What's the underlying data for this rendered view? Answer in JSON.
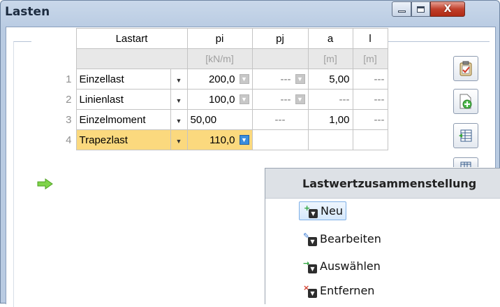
{
  "window": {
    "title": "Lasten",
    "minimize_icon": "minimize-icon",
    "maximize_icon": "maximize-icon",
    "close_glyph": "X"
  },
  "table": {
    "headers": {
      "type": "Lastart",
      "pi": "pi",
      "pj": "pj",
      "a": "a",
      "l": "l"
    },
    "units": {
      "pi": "[kN/m]",
      "a": "[m]",
      "l": "[m]"
    },
    "rows": [
      {
        "num": "1",
        "type": "Einzellast",
        "pi": "200,0",
        "pj": "---",
        "a": "5,00",
        "l": "---"
      },
      {
        "num": "2",
        "type": "Linienlast",
        "pi": "100,0",
        "pj": "---",
        "a": "---",
        "l": "---"
      },
      {
        "num": "3",
        "type": "Einzelmoment",
        "pi": "50,00",
        "pj": "---",
        "a": "1,00",
        "l": "---"
      },
      {
        "num": "4",
        "type": "Trapezlast",
        "pi": "110,0",
        "pj": "",
        "a": "",
        "l": ""
      }
    ],
    "selected_row": 4
  },
  "toolbar": {
    "buttons": [
      {
        "icon": "clipboard-icon"
      },
      {
        "icon": "new-document-icon"
      },
      {
        "icon": "insert-row-icon"
      },
      {
        "icon": "table-icon"
      }
    ]
  },
  "context_menu": {
    "title": "Lastwertzusammenstellung",
    "items": [
      {
        "label": "Neu",
        "icon": "new-icon",
        "highlighted": true
      },
      {
        "label": "Bearbeiten",
        "icon": "edit-icon",
        "highlighted": false
      },
      {
        "label": "Auswählen",
        "icon": "select-icon",
        "highlighted": false
      },
      {
        "label": "Entfernen",
        "icon": "remove-icon",
        "highlighted": false
      }
    ]
  },
  "colors": {
    "selected_row": "#fbd97e",
    "accent": "#3a8ddd",
    "menu_highlight": "#d6e8fb"
  }
}
